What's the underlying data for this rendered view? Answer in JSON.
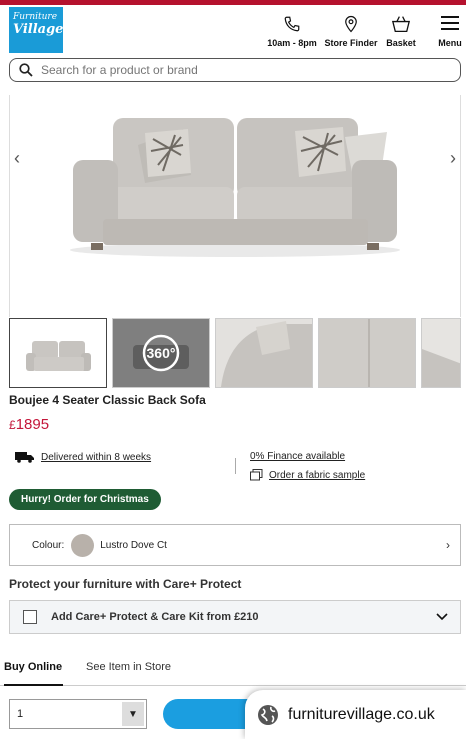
{
  "header": {
    "logo_line1": "Furniture",
    "logo_line2": "Village",
    "nav": [
      {
        "label": "10am - 8pm",
        "icon": "phone-icon"
      },
      {
        "label": "Store Finder",
        "icon": "map-pin-icon"
      },
      {
        "label": "Basket",
        "icon": "basket-icon"
      },
      {
        "label": "Menu",
        "icon": "hamburger-icon"
      }
    ]
  },
  "search": {
    "placeholder": "Search for a product or brand"
  },
  "gallery": {
    "prev": "‹",
    "next": "›",
    "badge_360": "360°"
  },
  "product": {
    "title": "Boujee 4 Seater Classic Back Sofa",
    "currency": "£",
    "price": "1895"
  },
  "info": {
    "delivery": "Delivered within 8 weeks",
    "finance": "0% Finance available",
    "sample": "Order a fabric sample"
  },
  "badge": "Hurry! Order for Christmas",
  "colour": {
    "label": "Colour:",
    "value": "Lustro Dove Ct",
    "swatch": "#b8b1aa"
  },
  "protect": {
    "heading": "Protect your furniture with Care+ Protect",
    "option": "Add Care+ Protect & Care Kit from £210"
  },
  "tabs": {
    "active": "Buy Online",
    "other": "See Item in Store"
  },
  "quantity": {
    "value": "1"
  },
  "browser": {
    "url": "furniturevillage.co.uk"
  },
  "colors": {
    "brand_red": "#b5122e",
    "logo_blue": "#1a9bd7",
    "price_red": "#c4163a",
    "badge_green": "#1f5c34",
    "button_blue": "#1b9ee0"
  }
}
